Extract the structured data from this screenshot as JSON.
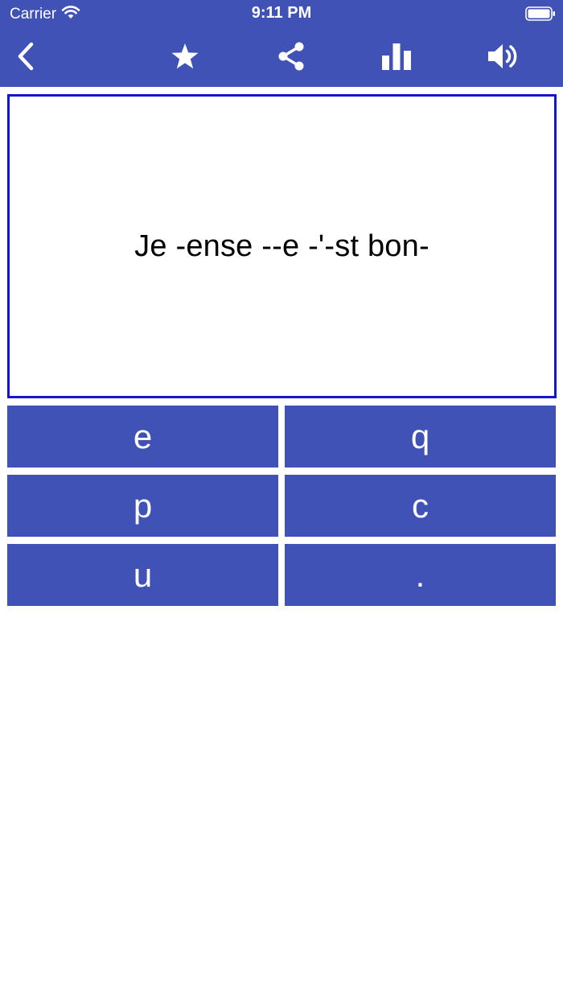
{
  "status_bar": {
    "carrier": "Carrier",
    "time": "9:11 PM"
  },
  "toolbar": {
    "icons": [
      "back-icon",
      "star-icon",
      "share-icon",
      "bar-chart-icon",
      "speaker-icon"
    ],
    "icon_color": "#ffffff",
    "background_color": "#4152b6"
  },
  "quiz": {
    "sentence": "Je -ense --e -'-st bon-",
    "card_border_color": "#1414d4"
  },
  "choices": [
    "e",
    "q",
    "p",
    "c",
    "u",
    "."
  ]
}
